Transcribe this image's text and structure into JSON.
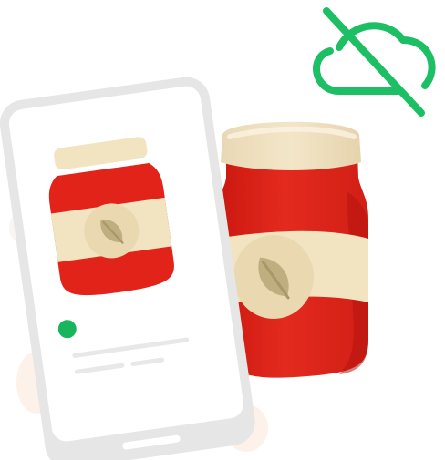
{
  "illustration": {
    "icons": {
      "cloud_off": "cloud-off-icon",
      "leaf": "leaf-icon",
      "status_dot": "status-dot"
    },
    "colors": {
      "jar_red": "#e2231a",
      "jar_red_dark": "#b5140f",
      "jar_label": "#f2e3c1",
      "jar_lid": "#eedfbf",
      "leaf": "#bfae80",
      "status_green": "#19b45e",
      "cloud_off_green": "#1cbf63",
      "phone_frame": "#e6e6e6",
      "phone_screen": "#ffffff"
    }
  }
}
